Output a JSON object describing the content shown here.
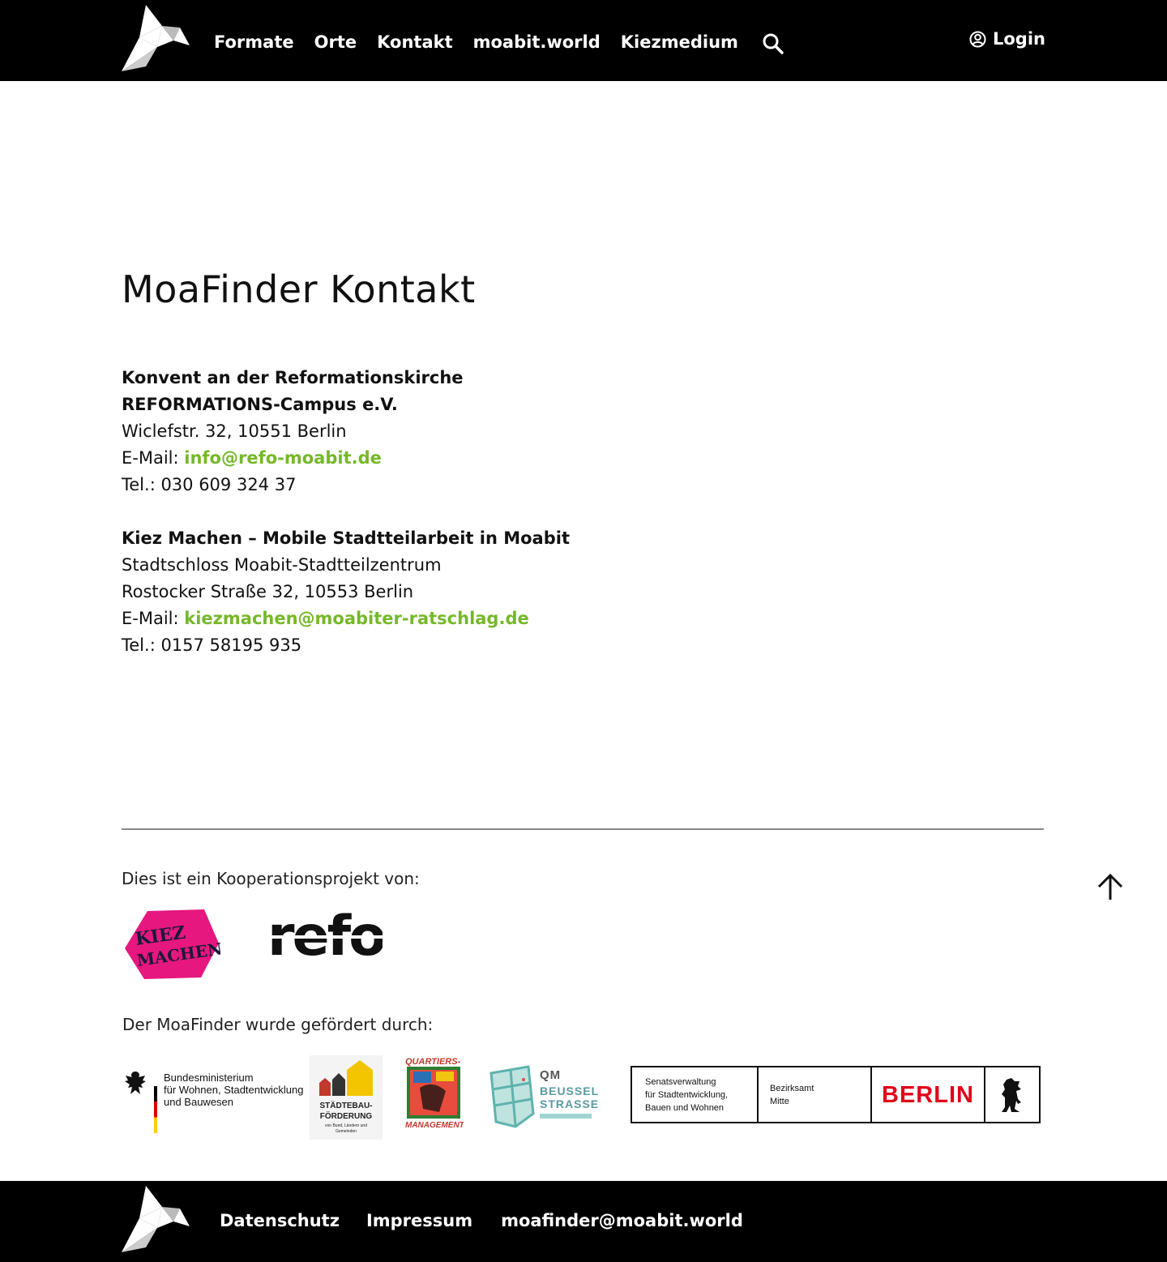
{
  "header": {
    "nav": [
      "Formate",
      "Orte",
      "Kontakt",
      "moabit.world",
      "Kiezmedium"
    ],
    "login_label": "Login",
    "icons": {
      "logo": "origami-bird-logo",
      "search": "search-icon",
      "user": "user-icon"
    }
  },
  "main": {
    "title": "MoaFinder Kontakt",
    "contacts": [
      {
        "org_lines": [
          "Konvent an der Reformationskirche",
          "REFORMATIONS-Campus e.V."
        ],
        "address": "Wiclefstr. 32, 10551 Berlin",
        "email_prefix": "E-Mail: ",
        "email": "info@refo-moabit.de",
        "phone": "Tel.: 030 609 324 37"
      },
      {
        "org_lines": [
          "Kiez Machen – Mobile Stadtteilarbeit in Moabit"
        ],
        "address_lines": [
          "Stadtschloss Moabit-Stadtteilzentrum",
          "Rostocker Straße 32, 10553 Berlin"
        ],
        "email_prefix": "E-Mail: ",
        "email": "kiezmachen@moabiter-ratschlag.de",
        "phone": "Tel.: 0157 58195 935"
      }
    ]
  },
  "partners": {
    "intro": "Dies ist ein Kooperationsprojekt von:",
    "logos": {
      "kiez": {
        "lines": [
          "KIEZ",
          "MACHEN"
        ],
        "color": "#e6177e"
      },
      "refo": {
        "text": "refo"
      }
    }
  },
  "funding": {
    "intro": "Der MoaFinder wurde gefördert durch:",
    "bmwsb": [
      "Bundesministerium",
      "für Wohnen, Stadtentwicklung",
      "und Bauwesen"
    ],
    "staedtebau": {
      "title_lines": [
        "STÄDTEBAU-",
        "FÖRDERUNG"
      ],
      "sub_lines": [
        "von Bund, Ländern und",
        "Gemeinden"
      ]
    },
    "qm": {
      "top": "QUARTIERS-",
      "bottom": "MANAGEMENT"
    },
    "qm_beussel": [
      "QM",
      "BEUSSEL",
      "STRASSE"
    ],
    "senat": {
      "cell1": [
        "Senatsverwaltung",
        "für Stadtentwicklung,",
        "Bauen und Wohnen"
      ],
      "cell2": [
        "Bezirksamt",
        "Mitte"
      ],
      "cell3": "BERLIN"
    }
  },
  "footer": {
    "links": [
      "Datenschutz",
      "Impressum",
      "moafinder@moabit.world"
    ]
  },
  "colors": {
    "accent_green": "#76b82a",
    "bar": "#000000",
    "berlin_red": "#e2001a",
    "kiez_pink": "#e6177e"
  }
}
